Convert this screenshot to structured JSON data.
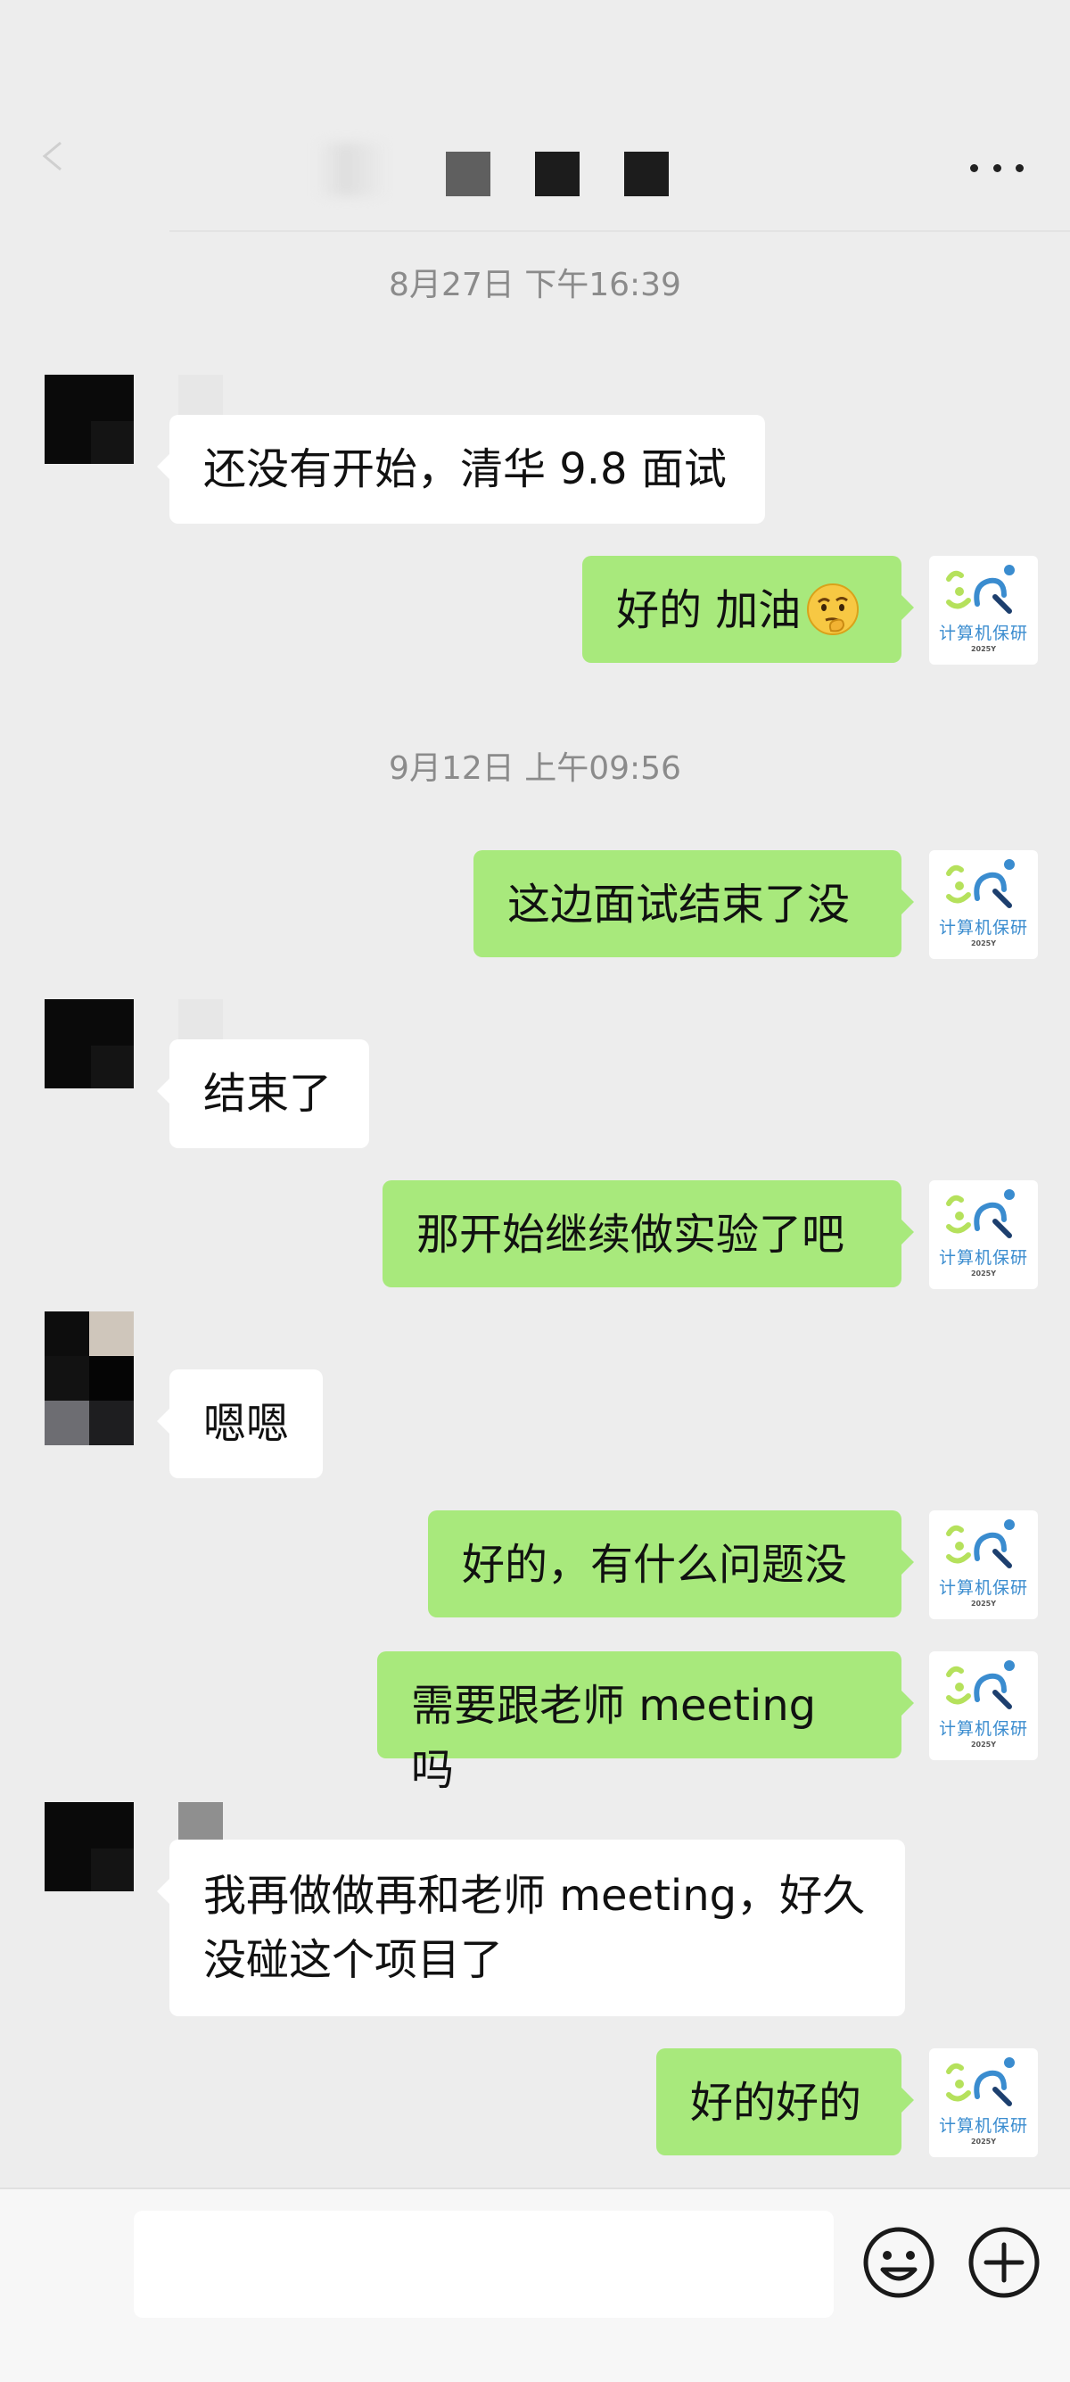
{
  "header": {
    "back_icon": "chevron-left-icon",
    "more_icon": "more-dots-icon"
  },
  "timestamps": [
    "8月27日 下午16:39",
    "9月12日 上午09:56"
  ],
  "avatar_logo": {
    "name": "计算机保研",
    "sub": "2025Y",
    "colors": {
      "green": "#b5e15c",
      "blue": "#3a8ccf",
      "dark": "#1d3f6e"
    }
  },
  "messages": [
    {
      "side": "left",
      "text": "还没有开始，清华 9.8 面试"
    },
    {
      "side": "right",
      "text": "好的 加油",
      "emoji": "thinking-face"
    },
    {
      "side": "right",
      "text": "这边面试结束了没"
    },
    {
      "side": "left",
      "text": "结束了"
    },
    {
      "side": "right",
      "text": "那开始继续做实验了吧"
    },
    {
      "side": "left",
      "text": "嗯嗯"
    },
    {
      "side": "right",
      "text": "好的，有什么问题没"
    },
    {
      "side": "right",
      "text": "需要跟老师 meeting 吗"
    },
    {
      "side": "left",
      "lines": [
        "我再做做再和老师 meeting，好久",
        "没碰这个项目了"
      ]
    },
    {
      "side": "right",
      "text": "好的好的"
    }
  ],
  "input_bar": {
    "value": "",
    "emoji_icon": "emoji-smile-icon",
    "plus_icon": "plus-circle-icon"
  },
  "colors": {
    "background": "#ededed",
    "bubble_sent": "#a8e97c",
    "bubble_received": "#ffffff",
    "timestamp_text": "#8b8b8b"
  }
}
